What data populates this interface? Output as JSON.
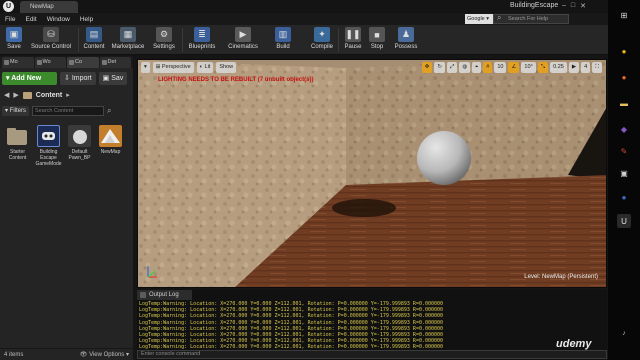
{
  "title_bar": {
    "tab_title": "NewMap",
    "project_name": "BuildingEscape",
    "buttons": [
      "–",
      "□",
      "✕"
    ]
  },
  "menubar": {
    "items": [
      "File",
      "Edit",
      "Window",
      "Help"
    ]
  },
  "help_search": {
    "selector": "Google ▾",
    "placeholder": "Search For Help"
  },
  "toolbar": {
    "buttons": [
      {
        "label": "Save",
        "icon": "floppy-disk-icon",
        "color": "#3f6aa8"
      },
      {
        "label": "Source Control",
        "icon": "source-control-icon",
        "color": "#4a4a4a"
      },
      {
        "label": "Content",
        "icon": "content-icon",
        "color": "#355a8a"
      },
      {
        "label": "Marketplace",
        "icon": "marketplace-icon",
        "color": "#4b5a6a"
      },
      {
        "label": "Settings",
        "icon": "gear-icon",
        "color": "#555555"
      },
      {
        "label": "Blueprints",
        "icon": "blueprints-icon",
        "color": "#3a5f9a"
      },
      {
        "label": "Cinematics",
        "icon": "cinematics-icon",
        "color": "#5a5a5a"
      },
      {
        "label": "Build",
        "icon": "build-icon",
        "color": "#3a5f9a"
      },
      {
        "label": "Compile",
        "icon": "compile-icon",
        "color": "#3a6a9a"
      },
      {
        "label": "Pause",
        "icon": "pause-icon",
        "color": "#555555"
      },
      {
        "label": "Stop",
        "icon": "stop-icon",
        "color": "#555555"
      },
      {
        "label": "Possess",
        "icon": "possess-icon",
        "color": "#4a6a9a"
      }
    ]
  },
  "left_panel": {
    "tabs": [
      "Mo",
      "Wo",
      "Co",
      "Det"
    ],
    "add_new": "Add New",
    "import": "Import",
    "save": "Sav",
    "path": "Content",
    "filters": "Filters",
    "search_placeholder": "Search Content",
    "assets": [
      {
        "name": "Starter Content",
        "type": "folder"
      },
      {
        "name": "Building Escape GameMode",
        "type": "gamemode"
      },
      {
        "name": "Default Pawn_BP",
        "type": "pawn"
      },
      {
        "name": "NewMap",
        "type": "map"
      }
    ],
    "item_count": "4 items",
    "view_options": "View Options"
  },
  "viewport": {
    "perspective": "Perspective",
    "lit": "Lit",
    "show": "Show",
    "grid_size": "10",
    "rotation_snap": "10°",
    "scale_snap": "0.25",
    "camera_speed": "4",
    "warning": "LIGHTING NEEDS TO BE REBUILT (7 unbuilt object(s))",
    "level_label": "Level:",
    "level_name": "NewMap (Persistent)",
    "colors": {
      "warning": "#c81010",
      "accent": "#e2a022"
    }
  },
  "output_log": {
    "tab": "Output Log",
    "lines": [
      "LogTemp:Warning: Location: X=270.000 Y=0.000 Z=112.001, Rotation: P=0.000000 Y=-179.999893 R=0.000000",
      "LogTemp:Warning: Location: X=270.000 Y=0.000 Z=112.001, Rotation: P=0.000000 Y=-179.999893 R=0.000000",
      "LogTemp:Warning: Location: X=270.000 Y=0.000 Z=112.001, Rotation: P=0.000000 Y=-179.999893 R=0.000000",
      "LogTemp:Warning: Location: X=270.000 Y=0.000 Z=112.001, Rotation: P=0.000000 Y=-179.999893 R=0.000000",
      "LogTemp:Warning: Location: X=270.000 Y=0.000 Z=112.001, Rotation: P=0.000000 Y=-179.999893 R=0.000000",
      "LogTemp:Warning: Location: X=270.000 Y=0.000 Z=112.001, Rotation: P=0.000000 Y=-179.999893 R=0.000000",
      "LogTemp:Warning: Location: X=270.000 Y=0.000 Z=112.001, Rotation: P=0.000000 Y=-179.999893 R=0.000000",
      "LogTemp:Warning: Location: X=270.000 Y=0.000 Z=112.001, Rotation: P=0.000000 Y=-179.999893 R=0.000000"
    ],
    "console_placeholder": "Enter console command",
    "log_color": "#d9c94b"
  },
  "watermark": "udemy",
  "taskbar": {
    "icons": [
      {
        "name": "chrome-icon",
        "color": "#e8b21f"
      },
      {
        "name": "firefox-icon",
        "color": "#e86a1f"
      },
      {
        "name": "folder-icon",
        "color": "#e3c05a"
      },
      {
        "name": "visual-studio-icon",
        "color": "#8a55c8"
      },
      {
        "name": "tools-icon",
        "color": "#d24a3a"
      },
      {
        "name": "epic-launcher-icon",
        "color": "#cfcfcf"
      },
      {
        "name": "blue-app-icon",
        "color": "#3a6fc8"
      },
      {
        "name": "unreal-engine-icon",
        "color": "#e8e8e8"
      }
    ]
  }
}
